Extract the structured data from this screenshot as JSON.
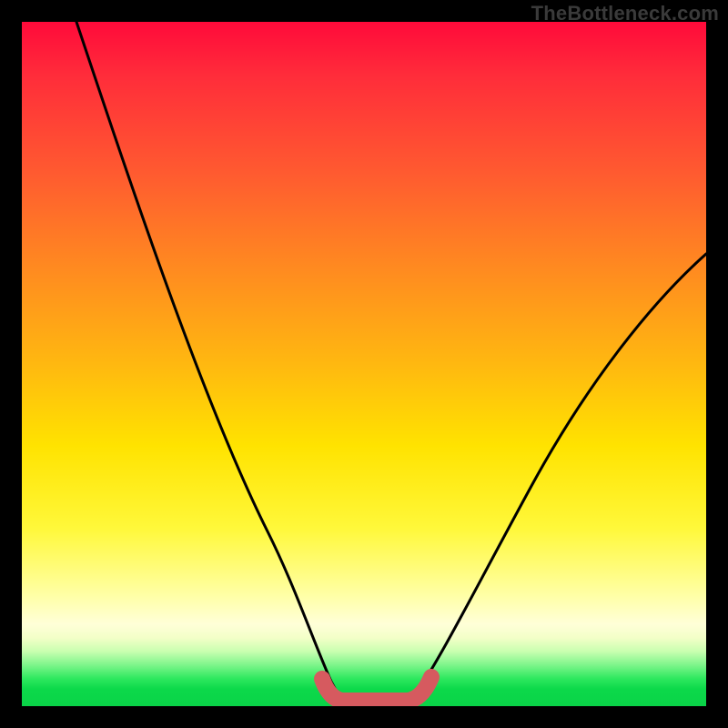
{
  "watermark": {
    "text": "TheBottleneck.com"
  },
  "colors": {
    "background": "#000000",
    "curve_stroke": "#000000",
    "highlight_stroke": "#d65a5f",
    "gradient_top": "#ff0a3a",
    "gradient_bottom": "#0ad348"
  },
  "chart_data": {
    "type": "line",
    "title": "",
    "xlabel": "",
    "ylabel": "",
    "xlim": [
      0,
      100
    ],
    "ylim": [
      0,
      100
    ],
    "grid": false,
    "legend": false,
    "series": [
      {
        "name": "bottleneck-curve-left",
        "x": [
          0,
          5,
          10,
          15,
          20,
          25,
          30,
          35,
          40,
          43,
          45
        ],
        "y": [
          100,
          90,
          79,
          67,
          54,
          41,
          29,
          18,
          8,
          1.5,
          0.5
        ]
      },
      {
        "name": "bottleneck-curve-right",
        "x": [
          55,
          58,
          62,
          68,
          75,
          82,
          90,
          100
        ],
        "y": [
          0.5,
          2,
          6,
          14,
          25,
          37,
          50,
          66
        ]
      },
      {
        "name": "sweet-spot-highlight",
        "x": [
          43,
          45,
          50,
          55,
          57
        ],
        "y": [
          2.5,
          0.5,
          0.5,
          0.5,
          2.5
        ]
      }
    ],
    "annotations": []
  }
}
